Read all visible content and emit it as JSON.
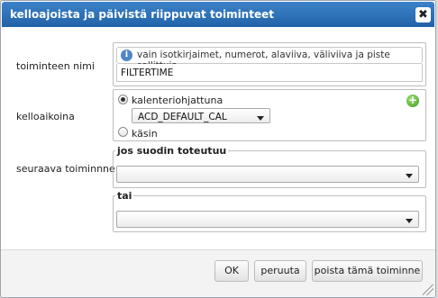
{
  "dialog": {
    "title": "kelloajoista ja päivistä riippuvat toiminteet",
    "close_symbol": "✖"
  },
  "form": {
    "name_label": "toiminteen nimi",
    "name_hint": "vain isotkirjaimet, numerot, alaviiva, väliviiva ja piste sallittuja.",
    "name_value": "FILTERTIME",
    "time_label": "kelloaikoina",
    "calendar_option": "kalenteriohjattuna",
    "calendar_selected": "ACD_DEFAULT_CAL",
    "manual_option": "käsin",
    "next_label": "seuraava toiminnne",
    "if_legend": "jos suodin toteutuu",
    "if_selected": "",
    "else_legend": "tai",
    "else_selected": ""
  },
  "buttons": {
    "ok": "OK",
    "cancel": "peruuta",
    "delete": "poista tämä toiminne"
  },
  "icons": {
    "info": "info-icon",
    "add": "plus-circle-icon",
    "close": "close-icon",
    "dropdown": "chevron-down-icon"
  },
  "colors": {
    "titlebar": "#2b6fb4",
    "add_icon": "#3c9a1e"
  }
}
